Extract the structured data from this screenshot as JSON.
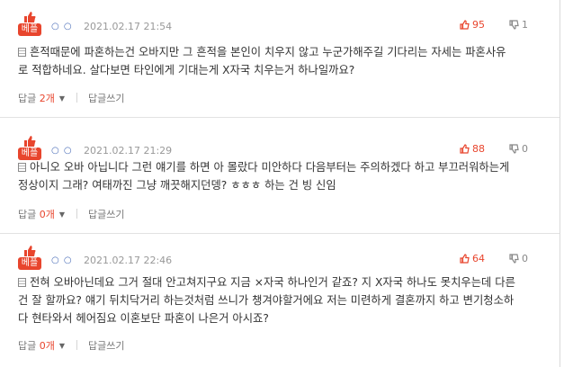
{
  "comments": [
    {
      "badge": "베플",
      "marks": "○ ○",
      "date": "2021.02.17 21:54",
      "up": "95",
      "down": "1",
      "lines": [
        "흔적때문에 파혼하는건 오바지만 그 흔적을 본인이 치우지 않고 누군가해주길 기다리는 자세는 파혼사유",
        "로 적합하네요. 살다보면 타인에게 기대는게 X자국 치우는거 하나일까요?"
      ],
      "reply_label": "답글",
      "reply_count": "2개",
      "write_label": "답글쓰기"
    },
    {
      "badge": "베플",
      "marks": "○ ○",
      "date": "2021.02.17 21:29",
      "up": "88",
      "down": "0",
      "lines": [
        "아니오 오바 아닙니다 그런 얘기를 하면 아 몰랐다 미안하다 다음부터는 주의하겠다 하고 부끄러워하는게",
        "정상이지 그래? 여태까진 그냥 깨끗해지던뎅? ㅎㅎㅎ 하는 건 빙 신임"
      ],
      "reply_label": "답글",
      "reply_count": "0개",
      "write_label": "답글쓰기"
    },
    {
      "badge": "베플",
      "marks": "○ ○",
      "date": "2021.02.17 22:46",
      "up": "64",
      "down": "0",
      "lines": [
        "전혀 오바아닌데요 그거 절대 안고쳐지구요 지금 ×자국 하나인거 같죠? 지 X자국 하나도 못치우는데 다른",
        "건 잘 할까요? 얘기 뒤치닥거리 하는것처럼 쓰니가 챙겨야할거에요 저는 미련하게 결혼까지 하고 변기청소하",
        "다 현타와서 헤어짐요 이혼보단 파혼이 나은거 아시죠?"
      ],
      "reply_label": "답글",
      "reply_count": "0개",
      "write_label": "답글쓰기"
    }
  ],
  "colors": {
    "accent": "#e8452d",
    "date": "#999999",
    "text": "#333333"
  },
  "icons": {
    "thumb": "thumbs-up-icon",
    "vote_up": "thumbs-up-outline-icon",
    "vote_down": "thumbs-down-outline-icon",
    "doc": "document-icon"
  }
}
